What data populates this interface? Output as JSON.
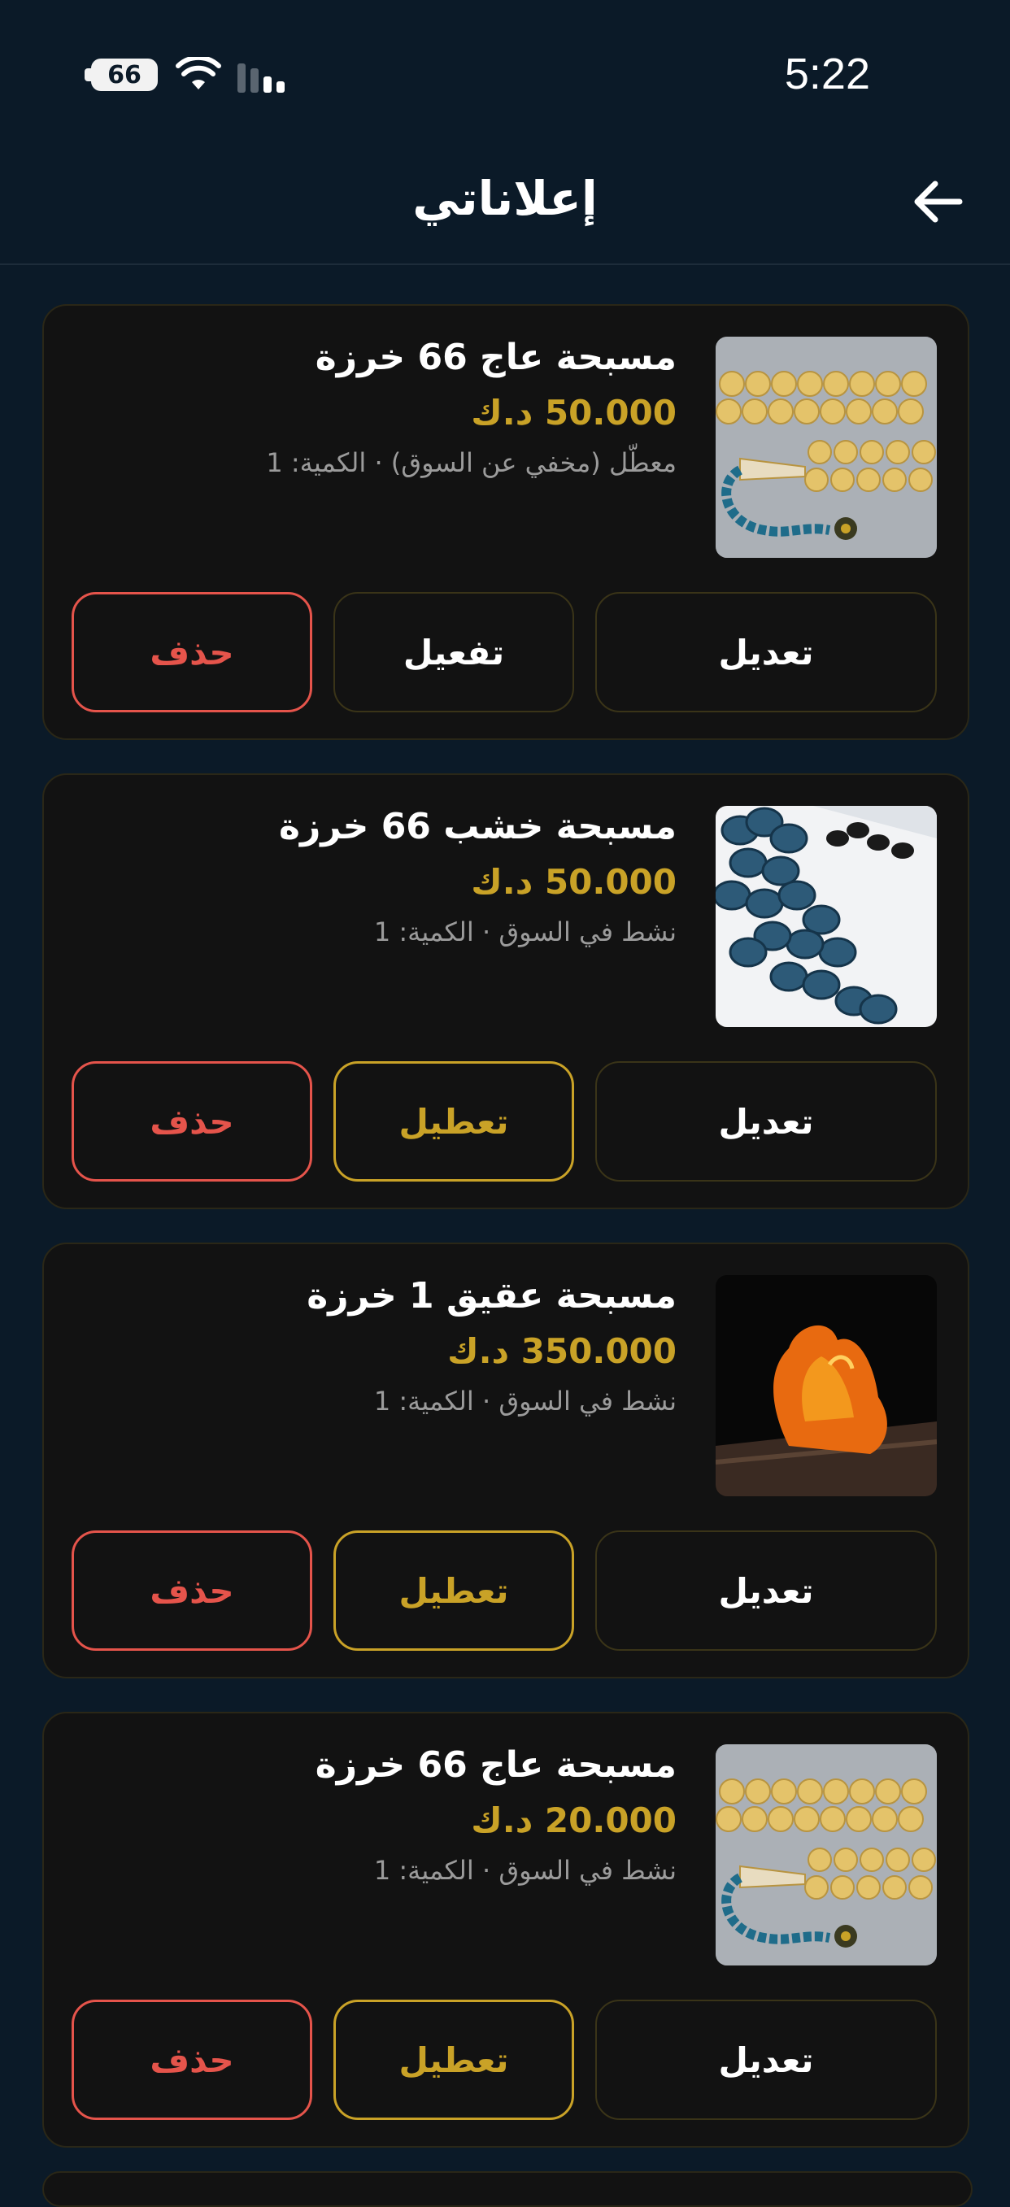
{
  "status_bar": {
    "battery": "66",
    "time": "5:22"
  },
  "header": {
    "title": "إعلاناتي"
  },
  "listings": [
    {
      "title": "مسبحة عاج 66 خرزة",
      "price": "50.000 د.ك",
      "meta": "معطّل (مخفي عن السوق) · الكمية: 1",
      "image": "ivory-beads",
      "edit_label": "تعديل",
      "toggle_label": "تفعيل",
      "toggle_active": false,
      "delete_label": "حذف"
    },
    {
      "title": "مسبحة خشب 66 خرزة",
      "price": "50.000 د.ك",
      "meta": "نشط في السوق · الكمية: 1",
      "image": "wood-beads",
      "edit_label": "تعديل",
      "toggle_label": "تعطيل",
      "toggle_active": true,
      "delete_label": "حذف"
    },
    {
      "title": "مسبحة عقيق 1 خرزة",
      "price": "350.000 د.ك",
      "meta": "نشط في السوق · الكمية: 1",
      "image": "amber-stone",
      "edit_label": "تعديل",
      "toggle_label": "تعطيل",
      "toggle_active": true,
      "delete_label": "حذف"
    },
    {
      "title": "مسبحة عاج 66 خرزة",
      "price": "20.000 د.ك",
      "meta": "نشط في السوق · الكمية: 1",
      "image": "ivory-beads",
      "edit_label": "تعديل",
      "toggle_label": "تعطيل",
      "toggle_active": true,
      "delete_label": "حذف"
    }
  ],
  "colors": {
    "background": "#0b1a28",
    "card": "#121212",
    "accent_gold": "#c9a227",
    "danger_red": "#e5544b",
    "muted_text": "#9b9b9b"
  },
  "icons": {
    "back": "arrow-right-icon",
    "wifi": "wifi-icon",
    "signal": "cellular-signal-icon",
    "battery": "battery-icon"
  }
}
